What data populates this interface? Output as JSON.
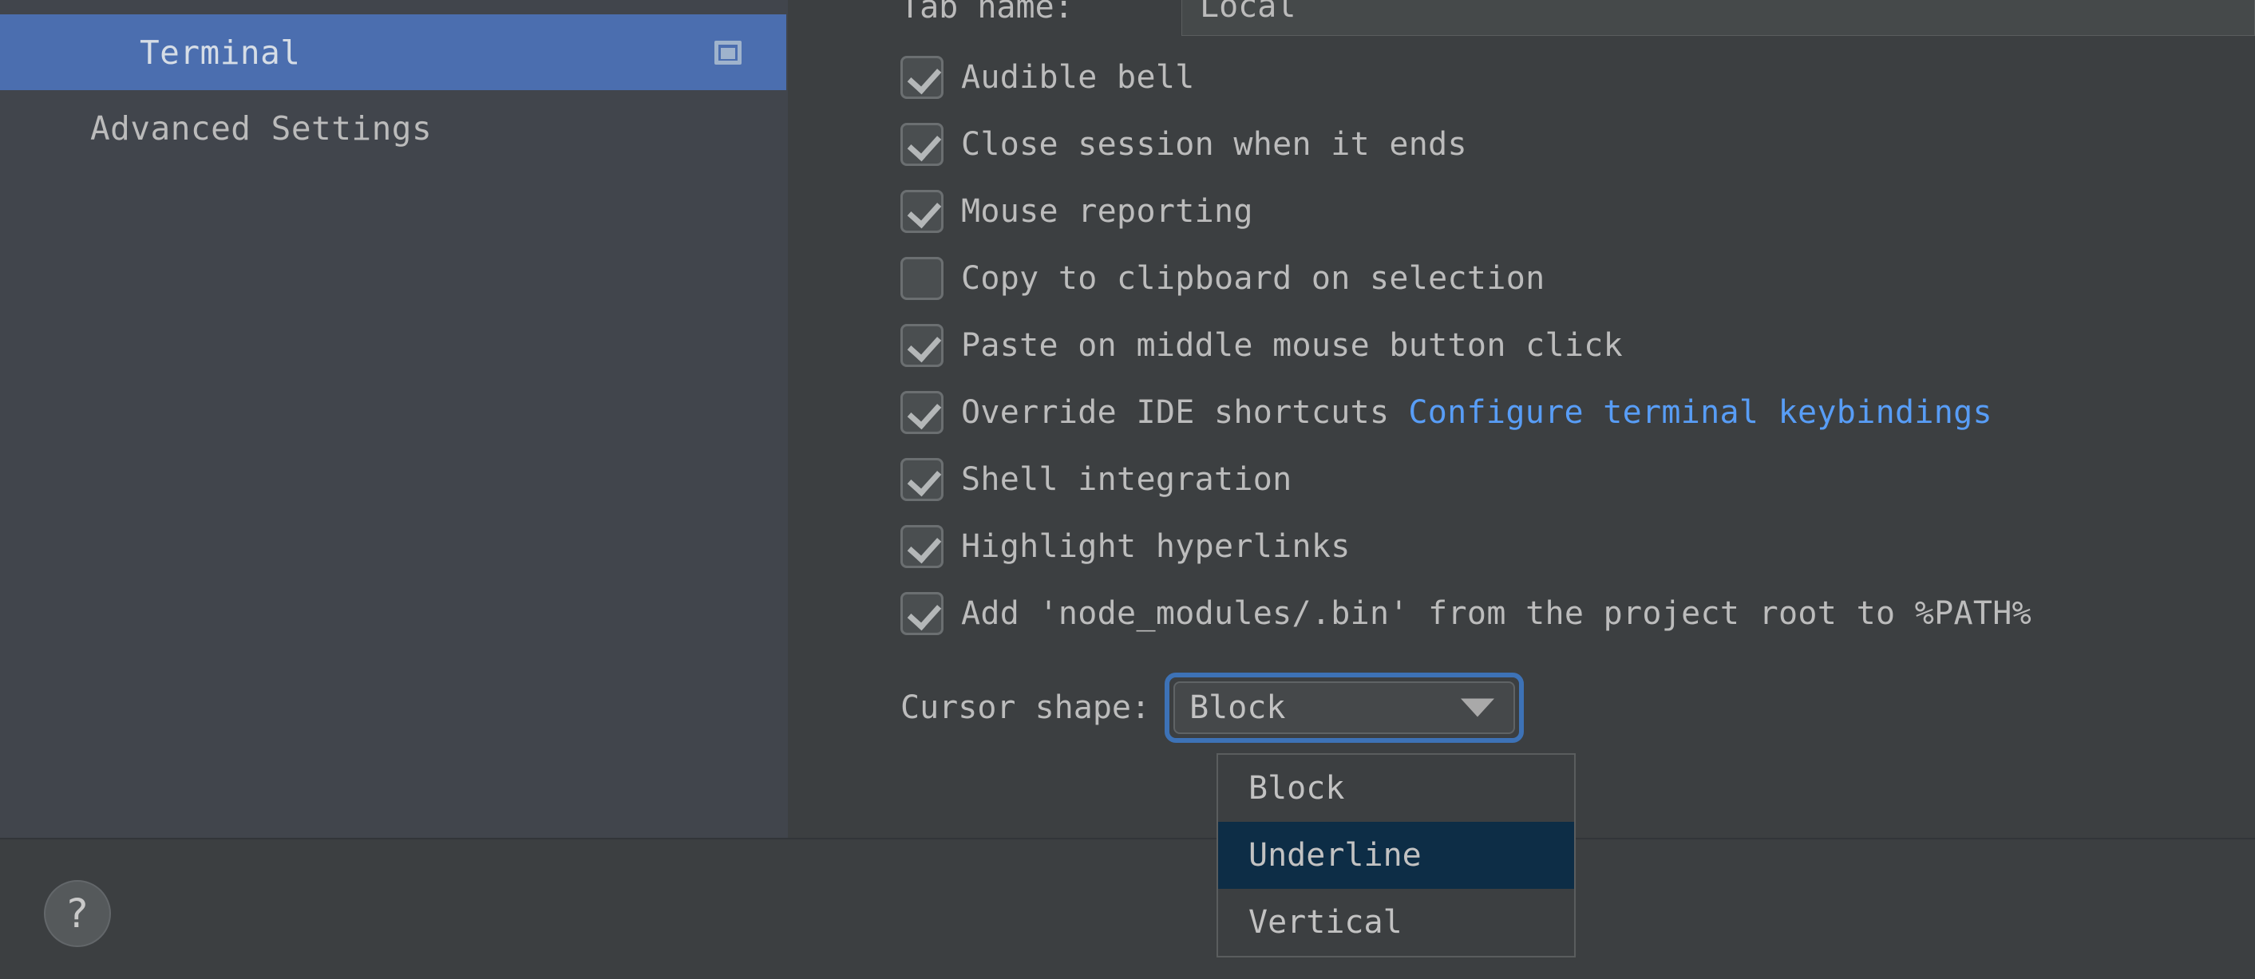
{
  "colors": {
    "selection_blue": "#4b6eaf",
    "link_blue": "#589df6",
    "popup_highlight": "#0d2d46",
    "focus_ring": "#3d72b6",
    "panel_bg": "#3c3f41",
    "sidebar_bg": "#41454c",
    "text": "#bbbbbb"
  },
  "sidebar": {
    "items": [
      {
        "label": "Terminal",
        "selected": true,
        "icon": "terminal-window-icon"
      },
      {
        "label": "Advanced Settings",
        "selected": false,
        "icon": null
      }
    ]
  },
  "content": {
    "tab_name": {
      "label": "Tab name:",
      "value": "Local",
      "placeholder": ""
    },
    "checkboxes": [
      {
        "label": "Audible bell",
        "checked": true
      },
      {
        "label": "Close session when it ends",
        "checked": true
      },
      {
        "label": "Mouse reporting",
        "checked": true
      },
      {
        "label": "Copy to clipboard on selection",
        "checked": false
      },
      {
        "label": "Paste on middle mouse button click",
        "checked": true
      },
      {
        "label": "Override IDE shortcuts",
        "checked": true,
        "link": "Configure terminal keybindings"
      },
      {
        "label": "Shell integration",
        "checked": true
      },
      {
        "label": "Highlight hyperlinks",
        "checked": true
      },
      {
        "label": "Add 'node_modules/.bin' from the project root to %PATH%",
        "checked": true
      }
    ],
    "cursor_shape": {
      "label": "Cursor shape:",
      "value": "Block",
      "arrow_icon": "chevron-down-icon",
      "options": [
        {
          "label": "Block",
          "highlighted": false
        },
        {
          "label": "Underline",
          "highlighted": true
        },
        {
          "label": "Vertical",
          "highlighted": false
        }
      ]
    }
  },
  "bottom_bar": {
    "help_label": "?"
  }
}
